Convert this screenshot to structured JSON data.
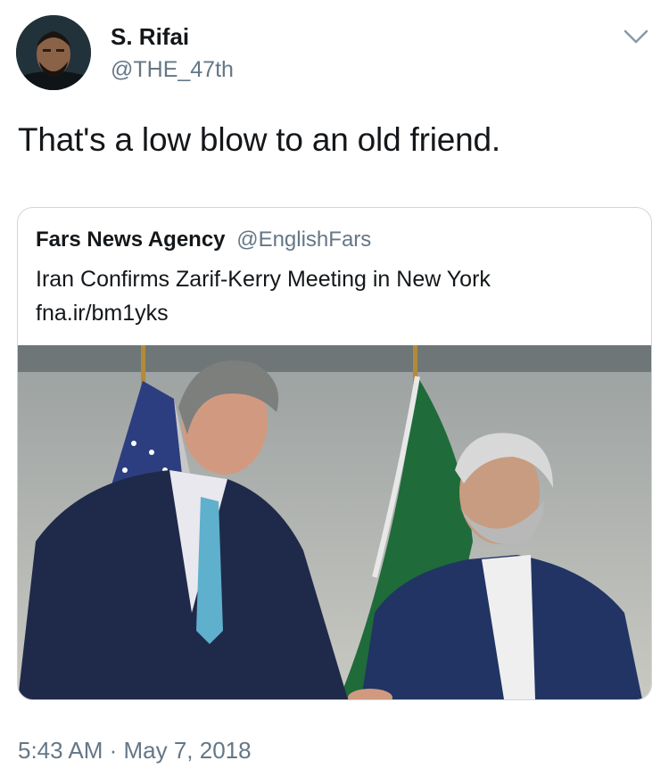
{
  "tweet": {
    "author_name": "S. Rifai",
    "author_handle": "@THE_47th",
    "text": "That's a low blow to an old friend.",
    "timestamp": "5:43 AM · May 7, 2018"
  },
  "quoted_tweet": {
    "author_name": "Fars News Agency",
    "author_handle": "@EnglishFars",
    "text": "Iran Confirms Zarif-Kerry Meeting in New York",
    "link": "fna.ir/bm1yks"
  },
  "colors": {
    "text_primary": "#14171a",
    "text_secondary": "#657786",
    "border": "#ccd6dd"
  },
  "icons": {
    "more_menu": "chevron-down-icon"
  }
}
